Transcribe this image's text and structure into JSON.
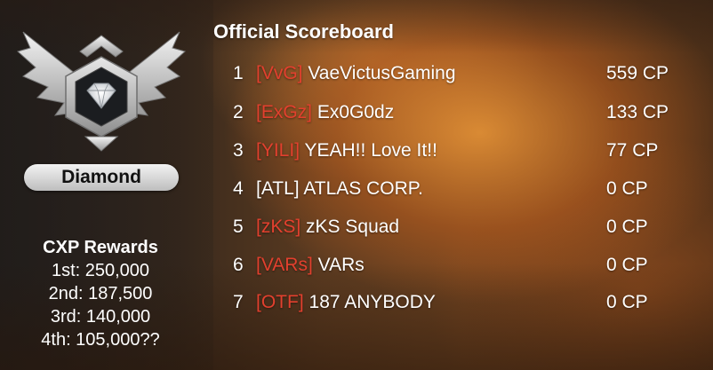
{
  "theme": {
    "tag_color": "#e2402e",
    "text_color": "#ffffff",
    "pill_color": "#d9d9d9"
  },
  "badge": {
    "icon": "diamond-rank-emblem-icon",
    "tier": "Diamond"
  },
  "rewards": {
    "title": "CXP Rewards",
    "lines": [
      "1st: 250,000",
      "2nd: 187,500",
      "3rd: 140,000",
      "4th: 105,000??"
    ]
  },
  "scoreboard": {
    "title": "Official Scoreboard",
    "rows": [
      {
        "rank": "1",
        "tag": "[VvG]",
        "name": "VaeVictusGaming",
        "score": "559 CP"
      },
      {
        "rank": "2",
        "tag": "[ExGz]",
        "name": "Ex0G0dz",
        "score": "133 CP"
      },
      {
        "rank": "3",
        "tag": "[YILI]",
        "name": "YEAH!! Love It!!",
        "score": "77 CP"
      },
      {
        "rank": "4",
        "tag": "[ATL]",
        "name": "ATLAS CORP.",
        "score": "0 CP"
      },
      {
        "rank": "5",
        "tag": "[zKS]",
        "name": "zKS Squad",
        "score": "0 CP"
      },
      {
        "rank": "6",
        "tag": "[VARs]",
        "name": "VARs",
        "score": "0 CP"
      },
      {
        "rank": "7",
        "tag": "[OTF]",
        "name": "187 ANYBODY",
        "score": "0 CP"
      }
    ]
  }
}
